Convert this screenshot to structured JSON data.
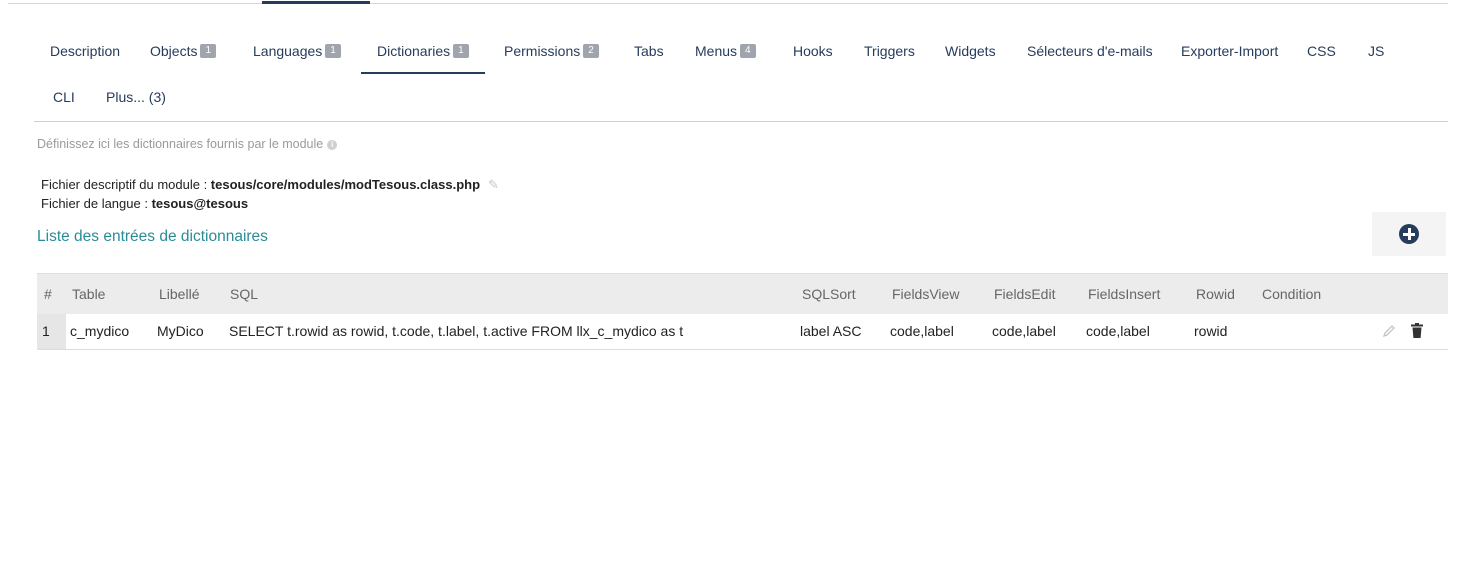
{
  "tabs": [
    {
      "label": "Description"
    },
    {
      "label": "Objects",
      "badge": "1"
    },
    {
      "label": "Languages",
      "badge": "1"
    },
    {
      "label": "Dictionaries",
      "badge": "1",
      "active": true
    },
    {
      "label": "Permissions",
      "badge": "2"
    },
    {
      "label": "Tabs"
    },
    {
      "label": "Menus",
      "badge": "4"
    },
    {
      "label": "Hooks"
    },
    {
      "label": "Triggers"
    },
    {
      "label": "Widgets"
    },
    {
      "label": "Sélecteurs d'e-mails"
    },
    {
      "label": "Exporter-Import"
    },
    {
      "label": "CSS"
    },
    {
      "label": "JS"
    },
    {
      "label": "CLI"
    },
    {
      "label": "Plus... (3)"
    }
  ],
  "intro": "Définissez ici les dictionnaires fournis par le module",
  "fileinfo": {
    "module_label": "Fichier descriptif du module : ",
    "module_path": "tesous/core/modules/modTesous.class.php",
    "lang_label": "Fichier de langue : ",
    "lang_value": "tesous@tesous"
  },
  "list_title": "Liste des entrées de dictionnaires",
  "table": {
    "headers": [
      "#",
      "Table",
      "Libellé",
      "SQL",
      "SQLSort",
      "FieldsView",
      "FieldsEdit",
      "FieldsInsert",
      "Rowid",
      "Condition"
    ],
    "rows": [
      [
        "1",
        "c_mydico",
        "MyDico",
        "SELECT t.rowid as rowid, t.code, t.label, t.active FROM llx_c_mydico as t",
        "label ASC",
        "code,label",
        "code,label",
        "code,label",
        "rowid",
        ""
      ]
    ]
  },
  "colors": {
    "accent": "#263c5c",
    "link": "#2a8c96",
    "badge": "#a0a4ad"
  }
}
